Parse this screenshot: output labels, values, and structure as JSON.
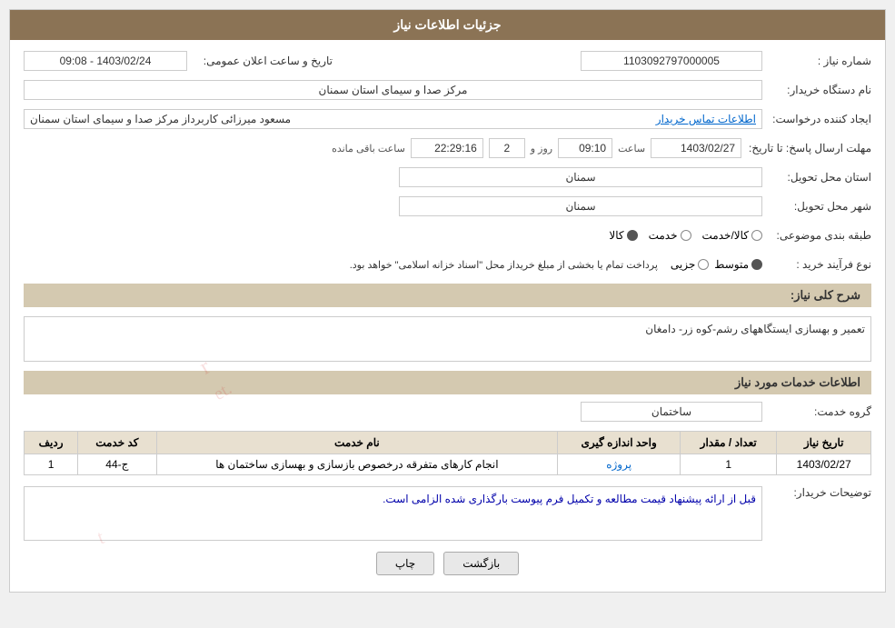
{
  "header": {
    "title": "جزئیات اطلاعات نیاز"
  },
  "fields": {
    "need_number_label": "شماره نیاز :",
    "need_number_value": "1103092797000005",
    "org_name_label": "نام دستگاه خریدار:",
    "org_name_value": "مرکز صدا و سیمای استان سمنان",
    "requester_label": "ایجاد کننده درخواست:",
    "requester_value": "مسعود میرزائی کاربرداز مرکز صدا و سیمای استان سمنان",
    "contact_link": "اطلاعات تماس خریدار",
    "deadline_label": "مهلت ارسال پاسخ: تا تاریخ:",
    "deadline_date": "1403/02/27",
    "deadline_time_label": "ساعت",
    "deadline_time": "09:10",
    "deadline_day_label": "روز و",
    "deadline_days": "2",
    "deadline_remaining_label": "ساعت باقی مانده",
    "deadline_remaining": "22:29:16",
    "province_label": "استان محل تحویل:",
    "province_value": "سمنان",
    "city_label": "شهر محل تحویل:",
    "city_value": "سمنان",
    "category_label": "طبقه بندی موضوعی:",
    "category_kala": "کالا",
    "category_khedmat": "خدمت",
    "category_kala_khedmat": "کالا/خدمت",
    "category_selected": "کالا",
    "process_label": "نوع فرآیند خرید :",
    "process_jozvi": "جزیی",
    "process_mottavaset": "متوسط",
    "process_description": "پرداخت تمام یا بخشی از مبلغ خریداز محل \"اسناد خزانه اسلامی\" خواهد بود.",
    "announce_date_label": "تاریخ و ساعت اعلان عمومی:",
    "announce_date_value": "1403/02/24 - 09:08",
    "need_description_label": "شرح کلی نیاز:",
    "need_description_value": "تعمیر و بهسازی ایستگاههای رشم-کوه زر- دامغان",
    "services_section_label": "اطلاعات خدمات مورد نیاز",
    "service_group_label": "گروه خدمت:",
    "service_group_value": "ساختمان",
    "table_headers": {
      "row_num": "ردیف",
      "service_code": "کد خدمت",
      "service_name": "نام خدمت",
      "unit": "واحد اندازه گیری",
      "quantity": "تعداد / مقدار",
      "need_date": "تاریخ نیاز"
    },
    "table_rows": [
      {
        "row_num": "1",
        "service_code": "ج-44",
        "service_name": "انجام کارهای متفرقه درخصوص بازسازی و بهسازی ساختمان ها",
        "unit": "پروژه",
        "quantity": "1",
        "need_date": "1403/02/27"
      }
    ],
    "buyer_notes_label": "توضیحات خریدار:",
    "buyer_notes_value": "قبل از ارائه پیشنهاد قیمت مطالعه و تکمیل فرم پیوست بارگذاری شده الزامی است.",
    "btn_print": "چاپ",
    "btn_back": "بازگشت"
  }
}
